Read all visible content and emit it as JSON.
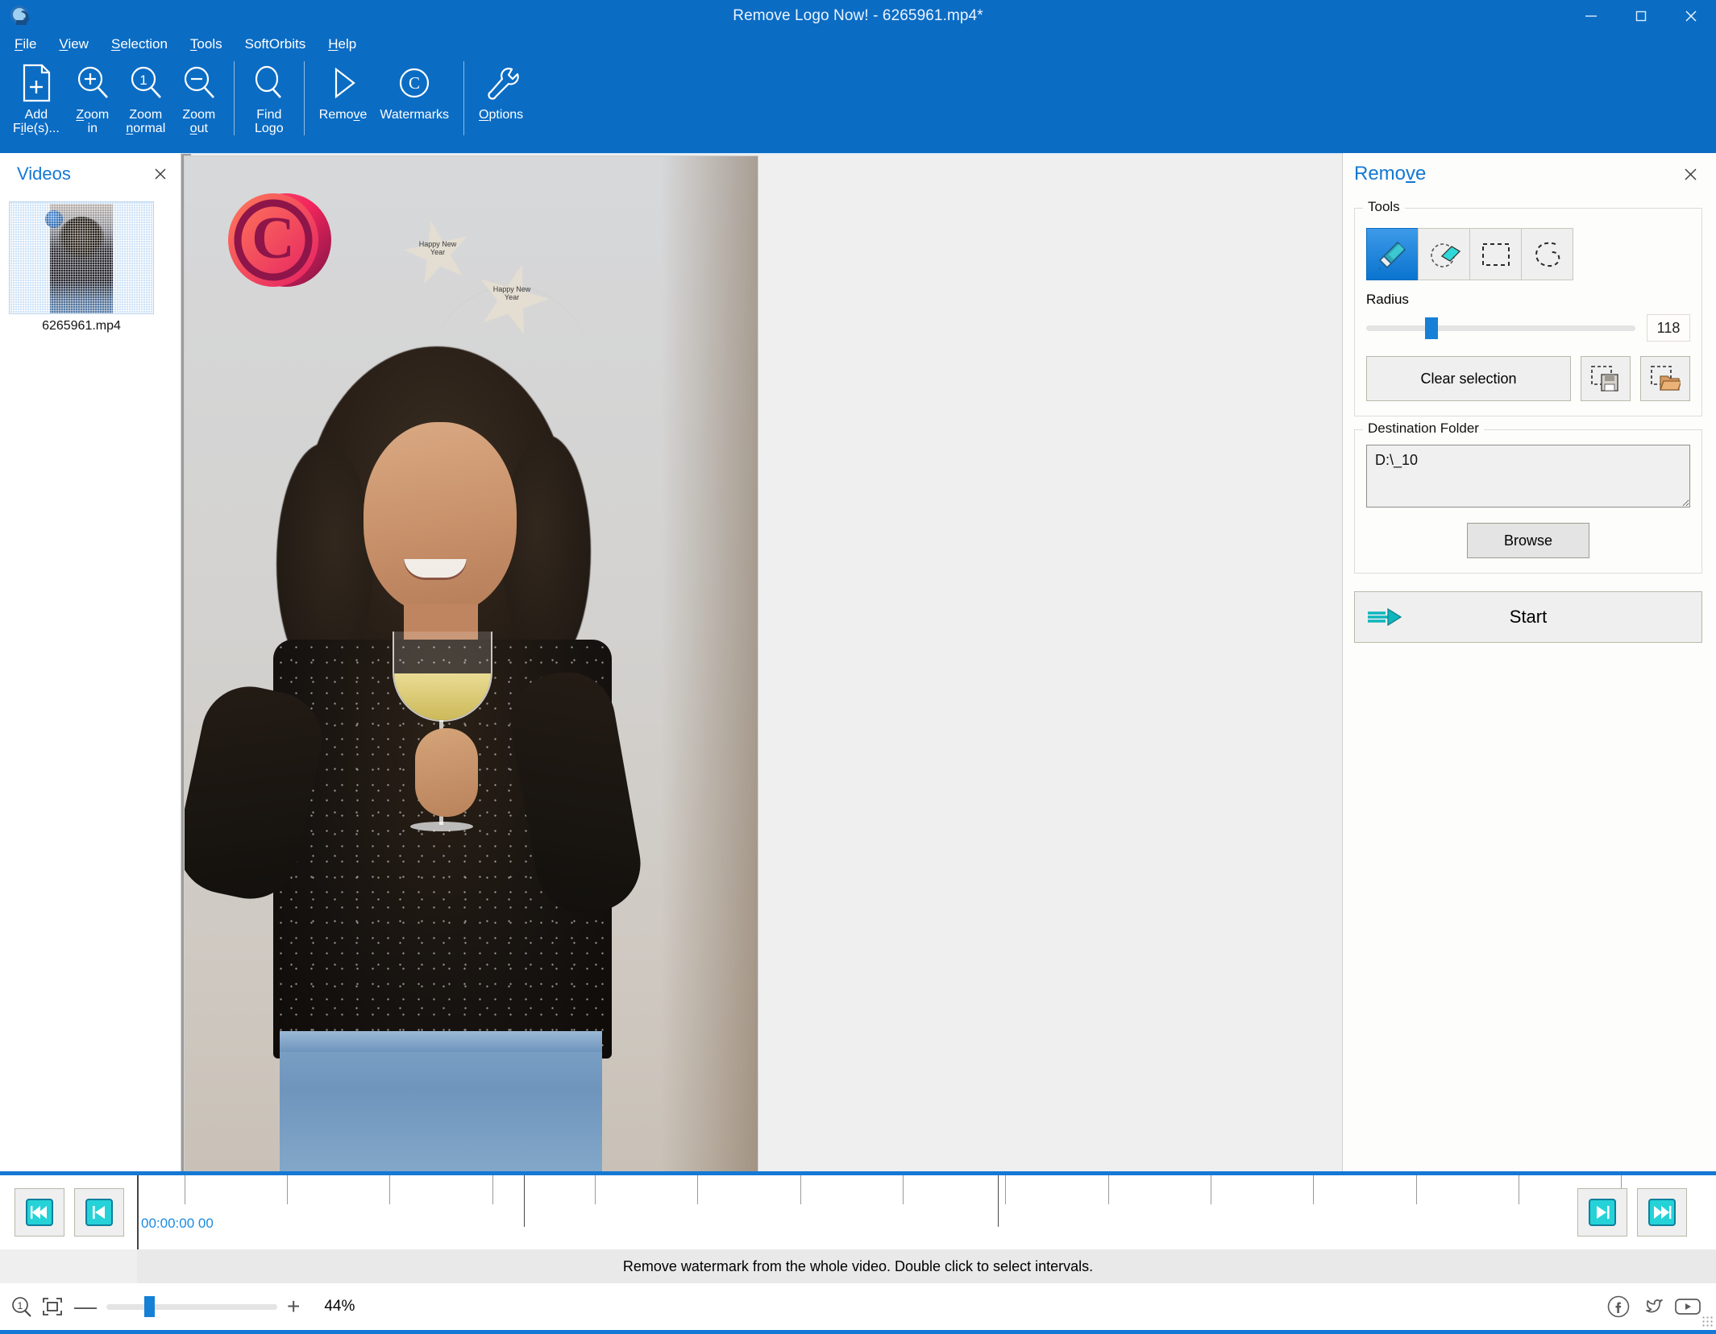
{
  "window": {
    "title": "Remove Logo Now! - 6265961.mp4*",
    "app_icon": "app-logo-icon",
    "minimize_label": "–",
    "maximize_label": "□",
    "close_label": "✕",
    "titlebar_color": "#0b6cc4"
  },
  "menubar": {
    "items": [
      {
        "name": "file",
        "pre": "",
        "accel": "F",
        "post": "ile"
      },
      {
        "name": "view",
        "pre": "",
        "accel": "V",
        "post": "iew"
      },
      {
        "name": "selection",
        "pre": "",
        "accel": "S",
        "post": "election"
      },
      {
        "name": "tools",
        "pre": "",
        "accel": "T",
        "post": "ools"
      },
      {
        "name": "softorbits",
        "pre": "SoftOrbits",
        "accel": "",
        "post": ""
      },
      {
        "name": "help",
        "pre": "",
        "accel": "H",
        "post": "elp"
      }
    ]
  },
  "ribbon": {
    "buttons": [
      {
        "name": "add-files",
        "icon": "add-file-icon",
        "line1": "Add",
        "line2": "File(s)...",
        "accel": "i"
      },
      {
        "name": "zoom-in",
        "icon": "zoom-in-icon",
        "line1": "Zoom",
        "line2": "in",
        "accel": "Z"
      },
      {
        "name": "zoom-normal",
        "icon": "zoom-normal-icon",
        "line1": "Zoom",
        "line2": "normal",
        "accel": "n"
      },
      {
        "name": "zoom-out",
        "icon": "zoom-out-icon",
        "line1": "Zoom",
        "line2": "out",
        "accel": "o"
      },
      {
        "name": "find-logo",
        "icon": "find-logo-icon",
        "line1": "Find",
        "line2": "Logo",
        "accel": ""
      },
      {
        "name": "remove",
        "icon": "play-icon",
        "line1": "Remove",
        "line2": "",
        "accel": "v"
      },
      {
        "name": "watermarks",
        "icon": "copyright-icon",
        "line1": "Watermarks",
        "line2": "",
        "accel": ""
      },
      {
        "name": "options",
        "icon": "wrench-icon",
        "line1": "Options",
        "line2": "",
        "accel": "O"
      }
    ]
  },
  "videos_panel": {
    "title": "Videos",
    "title_accent_color": "#1478d4",
    "close_label": "✕",
    "items": [
      {
        "name": "video-item",
        "filename": "6265961.mp4",
        "selected": true
      }
    ]
  },
  "canvas": {
    "watermark_text": "C",
    "star1_text": "Happy New Year",
    "star2_text": "Happy New Year",
    "background_color": "#efefef"
  },
  "remove_panel": {
    "title": "Remove",
    "title_accent_color": "#1478d4",
    "close_label": "✕",
    "tools_group_label": "Tools",
    "tools": [
      {
        "name": "marker-tool",
        "icon": "marker-icon",
        "active": true
      },
      {
        "name": "eraser-tool",
        "icon": "eraser-icon",
        "active": false
      },
      {
        "name": "rectangle-select-tool",
        "icon": "rectangle-select-icon",
        "active": false
      },
      {
        "name": "lasso-select-tool",
        "icon": "lasso-icon",
        "active": false
      }
    ],
    "radius_label": "Radius",
    "radius_value": "118",
    "radius_percent": 22,
    "clear_selection_label": "Clear selection",
    "save_selection_icon": "save-selection-icon",
    "load_selection_icon": "load-selection-icon",
    "destination_group_label": "Destination Folder",
    "destination_path": "D:\\_10",
    "destination_placeholder": "Destination folder",
    "browse_label": "Browse",
    "start_label": "Start",
    "start_icon": "arrow-right-icon"
  },
  "timeline": {
    "rewind_label": "rewind-icon",
    "prev_frame_label": "prev-frame-icon",
    "next_frame_label": "next-frame-icon",
    "fast_forward_label": "fast-forward-icon",
    "current_time": "00:00:00 00",
    "time_color": "#1a8ce0",
    "status_text": "Remove watermark from the whole video. Double click to select intervals.",
    "zoom_percent_label": "44%",
    "zoom_slider_percent": 22,
    "zoom_minus_label": "—",
    "zoom_plus_label": "+",
    "zoom_1to1_icon": "zoom-actual-size-icon",
    "zoom_fit_icon": "zoom-fit-icon",
    "ticks": [
      3,
      9.5,
      16,
      22.5,
      29,
      35.5,
      42,
      48.5,
      55,
      61.5,
      68,
      74.5,
      81,
      87.5,
      94
    ],
    "major_ticks": [
      24.5,
      54.5
    ],
    "socials": [
      {
        "name": "facebook-icon",
        "glyph": "f"
      },
      {
        "name": "twitter-icon",
        "glyph": "t"
      },
      {
        "name": "youtube-icon",
        "glyph": "y"
      }
    ]
  }
}
